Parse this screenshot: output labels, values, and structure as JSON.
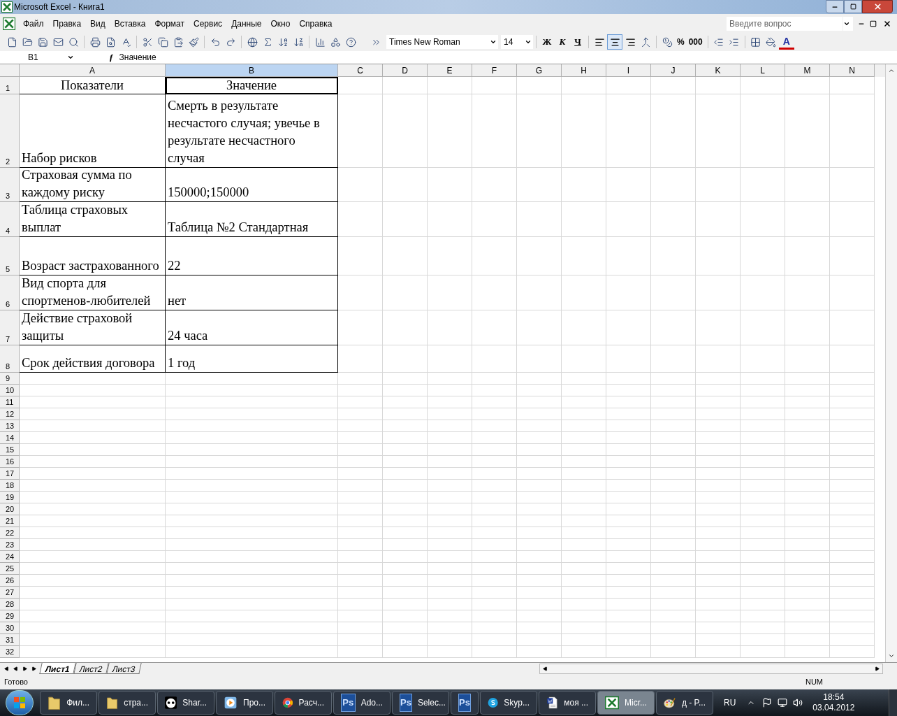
{
  "window": {
    "title": "Microsoft Excel - Книга1"
  },
  "menu": [
    "Файл",
    "Правка",
    "Вид",
    "Вставка",
    "Формат",
    "Сервис",
    "Данные",
    "Окно",
    "Справка"
  ],
  "help_search": {
    "placeholder": "Введите вопрос"
  },
  "font_box": {
    "value": "Times New Roman"
  },
  "size_box": {
    "value": "14"
  },
  "format_buttons": [
    {
      "label": "Ж",
      "kind": "bold"
    },
    {
      "label": "К",
      "kind": "italic"
    },
    {
      "label": "Ч",
      "kind": "underline"
    }
  ],
  "align_buttons": [
    {
      "kind": "left",
      "selected": false
    },
    {
      "kind": "center",
      "selected": true
    },
    {
      "kind": "right",
      "selected": false
    }
  ],
  "number_buttons": [
    "%",
    "000"
  ],
  "font_color_label": "A",
  "formula_bar": {
    "cell": "B1",
    "fx_label": "ƒ",
    "value": "Значение"
  },
  "columns": [
    {
      "label": "A",
      "selected": false
    },
    {
      "label": "B",
      "selected": true
    },
    {
      "label": "C",
      "selected": false
    },
    {
      "label": "D",
      "selected": false
    },
    {
      "label": "E",
      "selected": false
    },
    {
      "label": "F",
      "selected": false
    },
    {
      "label": "G",
      "selected": false
    },
    {
      "label": "H",
      "selected": false
    },
    {
      "label": "I",
      "selected": false
    },
    {
      "label": "J",
      "selected": false
    },
    {
      "label": "K",
      "selected": false
    },
    {
      "label": "L",
      "selected": false
    },
    {
      "label": "M",
      "selected": false
    },
    {
      "label": "N",
      "selected": false
    }
  ],
  "rows": [
    {
      "number": "1",
      "cells": [
        "Показатели",
        "Значение"
      ]
    },
    {
      "number": "2",
      "cells": [
        "Набор рисков",
        "Смерть в результате несчастого случая; увечье в результате несчастного случая"
      ]
    },
    {
      "number": "3",
      "cells": [
        "Страховая сумма по каждому риску",
        "150000;150000"
      ]
    },
    {
      "number": "4",
      "cells": [
        "Таблица страховых выплат",
        "Таблица №2 Стандартная"
      ]
    },
    {
      "number": "5",
      "cells": [
        "Возраст застрахованного",
        "22"
      ]
    },
    {
      "number": "6",
      "cells": [
        "Вид спорта для спортменов-любителей",
        "нет"
      ]
    },
    {
      "number": "7",
      "cells": [
        "Действие страховой защиты",
        "24 часа"
      ]
    },
    {
      "number": "8",
      "cells": [
        "Срок действия договора",
        "1 год"
      ]
    },
    {
      "number": "9"
    },
    {
      "number": "10"
    },
    {
      "number": "11"
    },
    {
      "number": "12"
    },
    {
      "number": "13"
    },
    {
      "number": "14"
    },
    {
      "number": "15"
    },
    {
      "number": "16"
    },
    {
      "number": "17"
    },
    {
      "number": "18"
    },
    {
      "number": "19"
    },
    {
      "number": "20"
    },
    {
      "number": "21"
    },
    {
      "number": "22"
    },
    {
      "number": "23"
    },
    {
      "number": "24"
    },
    {
      "number": "25"
    },
    {
      "number": "26"
    },
    {
      "number": "27"
    },
    {
      "number": "28"
    },
    {
      "number": "29"
    },
    {
      "number": "30"
    },
    {
      "number": "31"
    },
    {
      "number": "32"
    }
  ],
  "sheet_tabs": [
    {
      "label": "Лист1",
      "selected": true
    },
    {
      "label": "Лист2",
      "selected": false
    },
    {
      "label": "Лист3",
      "selected": false
    }
  ],
  "status_bar": {
    "left": "Готово",
    "right": "NUM"
  },
  "taskbar": {
    "items": [
      {
        "kind": "folder",
        "label": "Фил...",
        "active": false
      },
      {
        "kind": "folder",
        "label": "стра...",
        "active": false
      },
      {
        "kind": "panda",
        "label": "Shar...",
        "active": false
      },
      {
        "kind": "media",
        "label": "Про...",
        "active": false
      },
      {
        "kind": "chrome",
        "label": "Расч...",
        "active": false
      },
      {
        "kind": "ps",
        "icon_text": "Ps",
        "label": "Ado...",
        "active": false
      },
      {
        "kind": "ps",
        "icon_text": "Ps",
        "label": "Selec...",
        "active": false
      },
      {
        "kind": "ps",
        "icon_text": "Ps",
        "active": false
      },
      {
        "kind": "skype",
        "label": "Skyp...",
        "active": false
      },
      {
        "kind": "word",
        "label": "моя ...",
        "active": false
      },
      {
        "kind": "excel",
        "label": "Micr...",
        "active": true
      },
      {
        "kind": "paint",
        "label": "д - P...",
        "active": false
      }
    ],
    "language": "RU",
    "time": "18:54",
    "date": "03.04.2012"
  }
}
